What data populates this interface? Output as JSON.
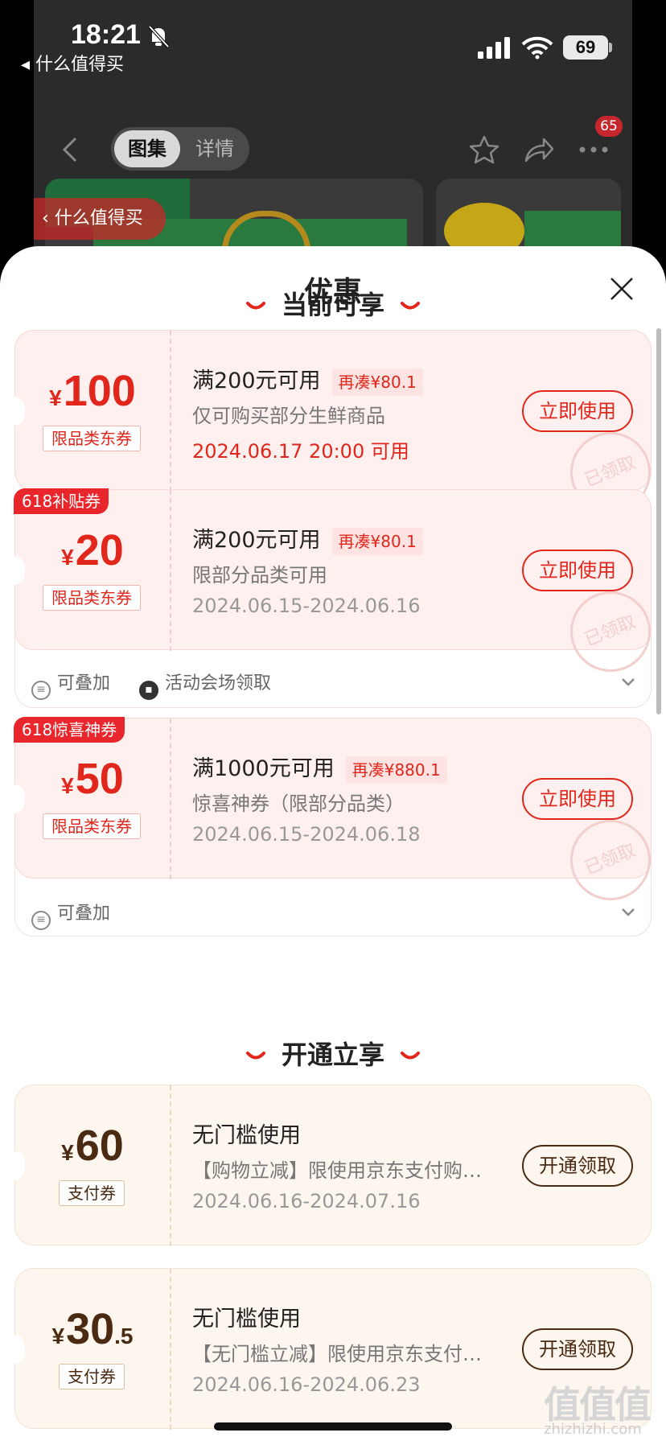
{
  "status_bar": {
    "time": "18:21",
    "back_app": "◂ 什么值得买",
    "battery": "69"
  },
  "product_page": {
    "tabs": [
      "图集",
      "详情"
    ],
    "badge_count": "65",
    "smzdm_pill": "‹ 什么值得买"
  },
  "sheet": {
    "title": "优惠",
    "section_current": "当前可享",
    "section_open": "开通立享"
  },
  "coupons": [
    {
      "currency": "¥",
      "amount": "100",
      "decimal": "",
      "tag": "限品类东券",
      "ribbon": "",
      "condition": "满200元可用",
      "still_need": "再凑¥80.1",
      "desc": "仅可购买部分生鲜商品",
      "date": "2024.06.17 20:00 可用",
      "button": "立即使用",
      "stamp": "已领取"
    },
    {
      "currency": "¥",
      "amount": "20",
      "decimal": "",
      "tag": "限品类东券",
      "ribbon": "618补贴券",
      "condition": "满200元可用",
      "still_need": "再凑¥80.1",
      "desc": "限部分品类可用",
      "date": "2024.06.15-2024.06.16",
      "button": "立即使用",
      "stamp": "已领取",
      "extras": [
        "可叠加",
        "活动会场领取"
      ]
    },
    {
      "currency": "¥",
      "amount": "50",
      "decimal": "",
      "tag": "限品类东券",
      "ribbon": "618惊喜神券",
      "condition": "满1000元可用",
      "still_need": "再凑¥880.1",
      "desc": "惊喜神券（限部分品类）",
      "date": "2024.06.15-2024.06.18",
      "button": "立即使用",
      "stamp": "已领取",
      "extras": [
        "可叠加"
      ]
    },
    {
      "currency": "¥",
      "amount": "60",
      "decimal": "",
      "tag": "支付券",
      "ribbon": "",
      "condition": "无门槛使用",
      "still_need": "",
      "desc": "【购物立减】限使用京东支付购…",
      "date": "2024.06.16-2024.07.16",
      "button": "开通领取",
      "stamp": ""
    },
    {
      "currency": "¥",
      "amount": "30",
      "decimal": ".5",
      "tag": "支付券",
      "ribbon": "",
      "condition": "无门槛使用",
      "still_need": "",
      "desc": "【无门槛立减】限使用京东支付…",
      "date": "2024.06.16-2024.06.23",
      "button": "开通领取",
      "stamp": ""
    }
  ],
  "watermark": {
    "logo": "值值值",
    "site": "zhizhizhi.com"
  },
  "colors": {
    "accent": "#e1261c",
    "gold_text": "#4a2a12",
    "coupon_red_bg": "#fdf0ef",
    "coupon_gold_bg": "#fcf6ef"
  },
  "icons": [
    "bell-off-icon",
    "signal-icon",
    "wifi-icon",
    "back-icon",
    "star-icon",
    "share-icon",
    "more-icon",
    "close-icon",
    "stack-icon",
    "venue-icon",
    "chevron-down-icon"
  ]
}
